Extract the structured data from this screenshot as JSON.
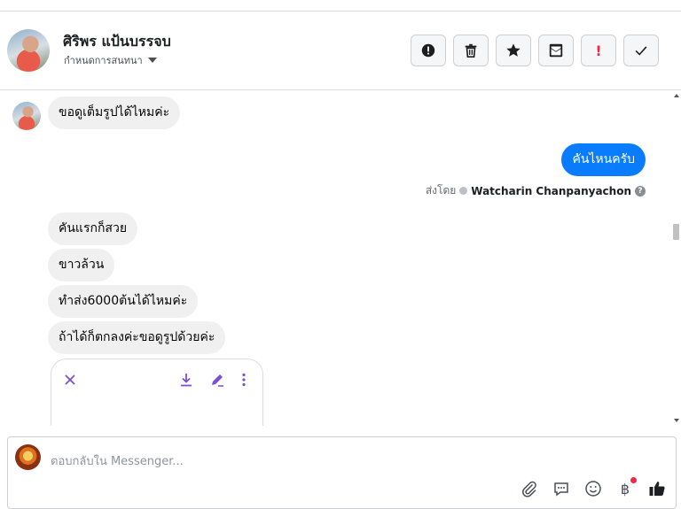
{
  "header": {
    "name": "ศิริพร แป้นบรรจบ",
    "assign_label": "กำหนดการสนทนา"
  },
  "actions": [
    {
      "icon": "alert-circle-icon"
    },
    {
      "icon": "trash-icon"
    },
    {
      "icon": "star-icon"
    },
    {
      "icon": "mail-icon"
    },
    {
      "icon": "exclamation-icon",
      "glyph": "!"
    },
    {
      "icon": "check-icon"
    }
  ],
  "messages": {
    "m1": "ขอดูเต็มรูปได้ไหมค่ะ",
    "m2": "คันไหนครับ",
    "sent_by_label": "ส่งโดย",
    "sent_by_name": "Watcharin Chanpanyachon",
    "help_glyph": "?",
    "m3": "คันแรกก็สวย",
    "m4": "ขาวล้วน",
    "m5": "ทำส่ง6000ต้นได้ไหมค่ะ",
    "m6": "ถ้าได้ก็ตกลงค่ะขอดูรูปด้วยค่ะ"
  },
  "composer": {
    "placeholder": "ตอบกลับใน Messenger...",
    "currency_glyph": "฿"
  },
  "colors": {
    "outgoing_bubble": "#0a7cff",
    "incoming_bubble": "#f0f0f0",
    "card_icon": "#7b4fd4",
    "alert_red": "#f02849"
  }
}
